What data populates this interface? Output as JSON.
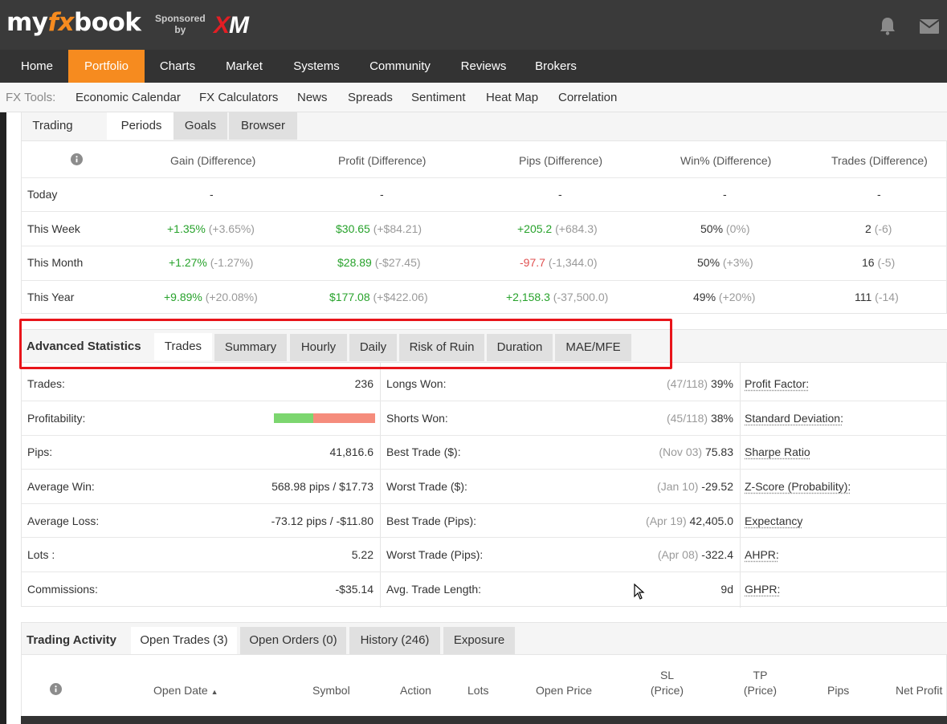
{
  "header": {
    "logo_my": "my",
    "logo_fx": "fx",
    "logo_book": "book",
    "sponsored_line1": "Sponsored",
    "sponsored_line2": "by",
    "sponsor_x": "X",
    "sponsor_m": "M",
    "icons": [
      "bell-icon",
      "mail-icon"
    ],
    "colors": {
      "accent": "#f68b1f",
      "topbar": "#3a3a3a",
      "nav": "#333333"
    }
  },
  "nav": {
    "items": [
      "Home",
      "Portfolio",
      "Charts",
      "Market",
      "Systems",
      "Community",
      "Reviews",
      "Brokers"
    ],
    "active": "Portfolio"
  },
  "fxtools": {
    "label": "FX Tools:",
    "items": [
      "Economic Calendar",
      "FX Calculators",
      "News",
      "Spreads",
      "Sentiment",
      "Heat Map",
      "Correlation"
    ]
  },
  "periods": {
    "tabs": [
      "Trading",
      "Periods",
      "Goals",
      "Browser"
    ],
    "selected": "Periods",
    "info_icon": "info-icon",
    "headers": [
      "Gain (Difference)",
      "Profit (Difference)",
      "Pips (Difference)",
      "Win% (Difference)",
      "Trades (Difference)"
    ],
    "rows": [
      {
        "label": "Today",
        "gain": "-",
        "gain_diff": "",
        "profit": "-",
        "profit_diff": "",
        "pips": "-",
        "pips_diff": "",
        "win": "-",
        "win_diff": "",
        "trades": "-",
        "trades_diff": ""
      },
      {
        "label": "This Week",
        "gain": "+1.35%",
        "gain_diff": "(+3.65%)",
        "profit": "$30.65",
        "profit_diff": "(+$84.21)",
        "pips": "+205.2",
        "pips_diff": "(+684.3)",
        "win": "50%",
        "win_diff": "(0%)",
        "trades": "2",
        "trades_diff": "(-6)"
      },
      {
        "label": "This Month",
        "gain": "+1.27%",
        "gain_diff": "(-1.27%)",
        "profit": "$28.89",
        "profit_diff": "(-$27.45)",
        "pips": "-97.7",
        "pips_diff": "(-1,344.0)",
        "win": "50%",
        "win_diff": "(+3%)",
        "trades": "16",
        "trades_diff": "(-5)"
      },
      {
        "label": "This Year",
        "gain": "+9.89%",
        "gain_diff": "(+20.08%)",
        "profit": "$177.08",
        "profit_diff": "(+$422.06)",
        "pips": "+2,158.3",
        "pips_diff": "(-37,500.0)",
        "win": "49%",
        "win_diff": "(+20%)",
        "trades": "111",
        "trades_diff": "(-14)"
      }
    ]
  },
  "advanced": {
    "title": "Advanced Statistics",
    "tabs": [
      "Trades",
      "Summary",
      "Hourly",
      "Daily",
      "Risk of Ruin",
      "Duration",
      "MAE/MFE"
    ],
    "selected": "Trades",
    "col1": [
      {
        "label": "Trades:",
        "value": "236"
      },
      {
        "label": "Profitability:",
        "value": "",
        "win_share": 0.39
      },
      {
        "label": "Pips:",
        "value": "41,816.6"
      },
      {
        "label": "Average Win:",
        "value": "568.98 pips / $17.73"
      },
      {
        "label": "Average Loss:",
        "value": "-73.12 pips / -$11.80"
      },
      {
        "label": "Lots :",
        "value": "5.22"
      },
      {
        "label": "Commissions:",
        "value": "-$35.14"
      }
    ],
    "col2": [
      {
        "label": "Longs Won:",
        "note": "(47/118)",
        "value": "39%"
      },
      {
        "label": "Shorts Won:",
        "note": "(45/118)",
        "value": "38%"
      },
      {
        "label": "Best Trade ($):",
        "note": "(Nov 03)",
        "value": "75.83"
      },
      {
        "label": "Worst Trade ($):",
        "note": "(Jan 10)",
        "value": "-29.52"
      },
      {
        "label": "Best Trade (Pips):",
        "note": "(Apr 19)",
        "value": "42,405.0"
      },
      {
        "label": "Worst Trade (Pips):",
        "note": "(Apr 08)",
        "value": "-322.4"
      },
      {
        "label": "Avg. Trade Length:",
        "note": "",
        "value": "9d"
      }
    ],
    "col3": [
      "Profit Factor:",
      "Standard Deviation:",
      "Sharpe Ratio",
      "Z-Score (Probability):",
      "Expectancy",
      "AHPR:",
      "GHPR:"
    ]
  },
  "activity": {
    "title": "Trading Activity",
    "tabs": [
      "Open Trades (3)",
      "Open Orders (0)",
      "History (246)",
      "Exposure"
    ],
    "selected": "Open Trades (3)",
    "columns": [
      "Open Date",
      "Symbol",
      "Action",
      "Lots",
      "Open Price",
      "SL",
      "(Price)",
      "TP",
      "(Price)",
      "Pips",
      "Net Profit"
    ],
    "sort_indicator": "▲"
  }
}
